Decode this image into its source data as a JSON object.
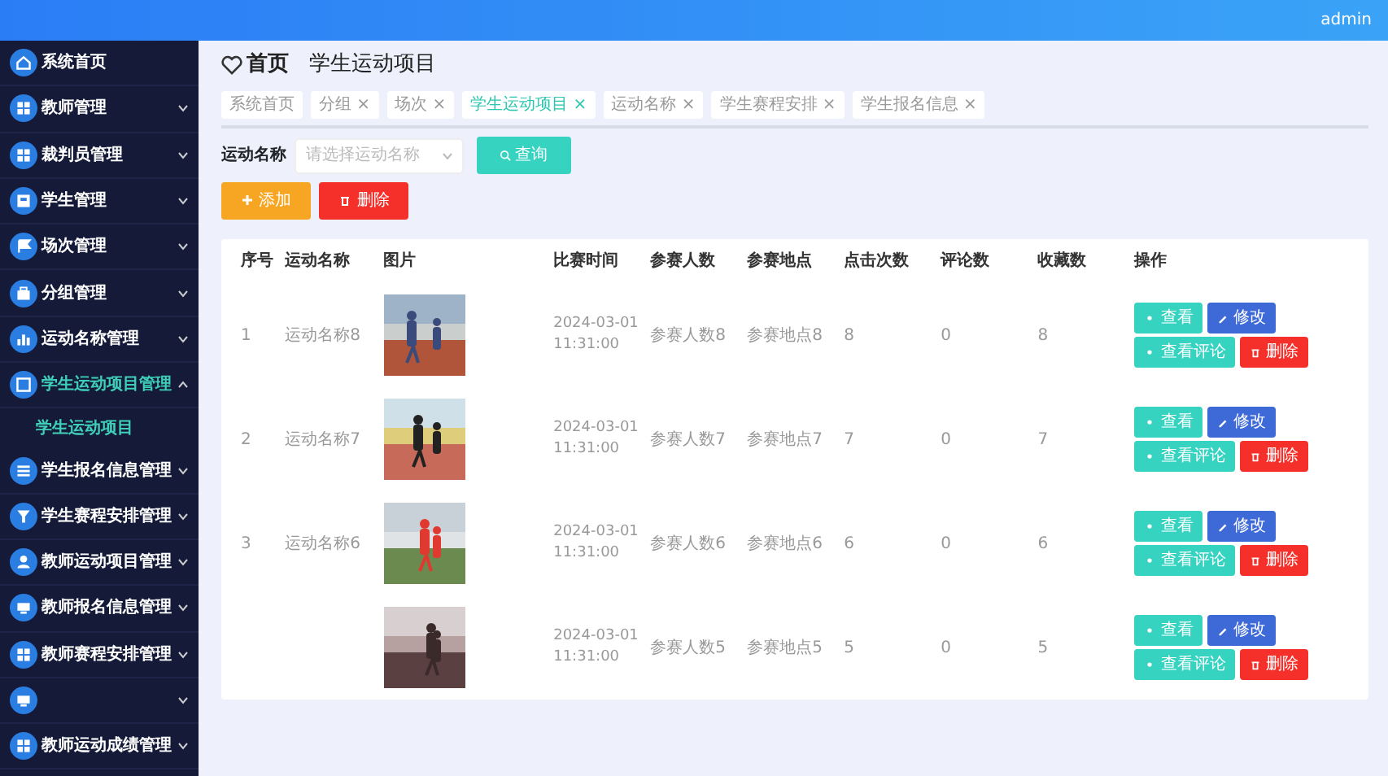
{
  "topbar": {
    "user": "admin"
  },
  "sidebar": {
    "items": [
      {
        "label": "系统首页",
        "expanded": false
      },
      {
        "label": "教师管理",
        "expanded": false,
        "has_children": true
      },
      {
        "label": "裁判员管理",
        "expanded": false,
        "has_children": true
      },
      {
        "label": "学生管理",
        "expanded": false,
        "has_children": true
      },
      {
        "label": "场次管理",
        "expanded": false,
        "has_children": true
      },
      {
        "label": "分组管理",
        "expanded": false,
        "has_children": true
      },
      {
        "label": "运动名称管理",
        "expanded": false,
        "has_children": true
      },
      {
        "label": "学生运动项目管理",
        "expanded": true,
        "has_children": true,
        "children": [
          {
            "label": "学生运动项目",
            "selected": true
          }
        ]
      },
      {
        "label": "学生报名信息管理",
        "expanded": false,
        "has_children": true
      },
      {
        "label": "学生赛程安排管理",
        "expanded": false,
        "has_children": true
      },
      {
        "label": "教师运动项目管理",
        "expanded": false,
        "has_children": true
      },
      {
        "label": "教师报名信息管理",
        "expanded": false,
        "has_children": true
      },
      {
        "label": "教师赛程安排管理",
        "expanded": false,
        "has_children": true
      },
      {
        "expanded": false,
        "has_children": true
      },
      {
        "label": "教师运动成绩管理",
        "expanded": false,
        "has_children": true
      }
    ]
  },
  "breadcrumb": {
    "home": "首页",
    "current": "学生运动项目"
  },
  "tabs": [
    {
      "label": "系统首页",
      "selected": false
    },
    {
      "label": "分组",
      "close": "×",
      "selected": false
    },
    {
      "label": "场次",
      "close": "×",
      "selected": false
    },
    {
      "label": "学生运动项目",
      "close": "×",
      "selected": true
    },
    {
      "label": "运动名称",
      "close": "×",
      "selected": false
    },
    {
      "label": "学生赛程安排",
      "close": "×",
      "selected": false
    },
    {
      "label": "学生报名信息",
      "close": "×",
      "selected": false
    }
  ],
  "search": {
    "label": "运动名称",
    "placeholder": "请选择运动名称",
    "button": "查询"
  },
  "actions": [
    {
      "label": "添加",
      "kind": "add"
    },
    {
      "label": "删除",
      "kind": "delete"
    }
  ],
  "table": {
    "columns": [
      "序号",
      "运动名称",
      "图片",
      "比赛时间",
      "参赛人数",
      "参赛地点",
      "点击次数",
      "评论数",
      "收藏数",
      "操作"
    ],
    "rows": [
      {
        "seq": "1",
        "name": "运动名称8",
        "time": "2024-03-01 11:31:00",
        "participants": "参赛人数8",
        "venue": "参赛地点8",
        "clicks": "8",
        "comments": "0",
        "favorites": "8",
        "actions": [
          {
            "label": "查看",
            "kind": "view"
          },
          {
            "label": "修改",
            "kind": "edit"
          },
          {
            "label": "查看评论",
            "kind": "comments"
          },
          {
            "label": "删除",
            "kind": "delete"
          }
        ]
      },
      {
        "seq": "2",
        "name": "运动名称7",
        "time": "2024-03-01 11:31:00",
        "participants": "参赛人数7",
        "venue": "参赛地点7",
        "clicks": "7",
        "comments": "0",
        "favorites": "7",
        "actions": [
          {
            "label": "查看",
            "kind": "view"
          },
          {
            "label": "修改",
            "kind": "edit"
          },
          {
            "label": "查看评论",
            "kind": "comments"
          },
          {
            "label": "删除",
            "kind": "delete"
          }
        ]
      },
      {
        "seq": "3",
        "name": "运动名称6",
        "time": "2024-03-01 11:31:00",
        "participants": "参赛人数6",
        "venue": "参赛地点6",
        "clicks": "6",
        "comments": "0",
        "favorites": "6",
        "actions": [
          {
            "label": "查看",
            "kind": "view"
          },
          {
            "label": "修改",
            "kind": "edit"
          },
          {
            "label": "查看评论",
            "kind": "comments"
          },
          {
            "label": "删除",
            "kind": "delete"
          }
        ]
      },
      {
        "time": "2024-03-01 11:31:00",
        "participants": "参赛人数5",
        "venue": "参赛地点5",
        "clicks": "5",
        "comments": "0",
        "favorites": "5",
        "actions": [
          {
            "label": "查看",
            "kind": "view"
          },
          {
            "label": "修改",
            "kind": "edit"
          },
          {
            "label": "查看评论",
            "kind": "comments"
          },
          {
            "label": "删除",
            "kind": "delete"
          }
        ]
      }
    ]
  }
}
